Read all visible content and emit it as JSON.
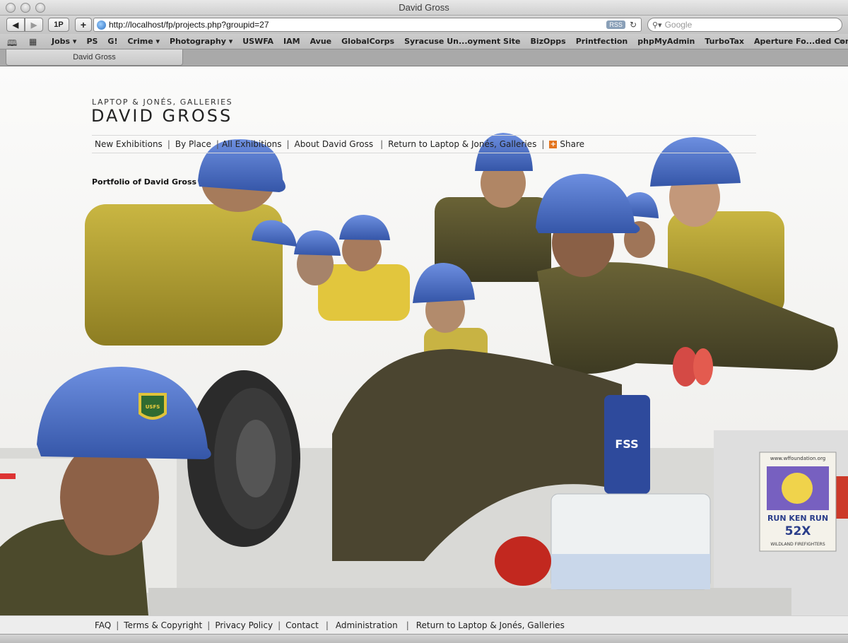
{
  "window": {
    "title": "David Gross"
  },
  "toolbar": {
    "back_icon": "back-arrow-icon",
    "forward_icon": "forward-arrow-icon",
    "onepassword_label": "1P",
    "add_label": "+",
    "url": "http://localhost/fp/projects.php?groupid=27",
    "rss_label": "RSS",
    "search_placeholder": "Google"
  },
  "bookmarks": {
    "items": [
      "Jobs ▾",
      "PS",
      "G!",
      "Crime ▾",
      "Photography ▾",
      "USWFA",
      "IAM",
      "Avue",
      "GlobalCorps",
      "Syracuse Un...oyment Site",
      "BizOpps",
      "Printfection",
      "phpMyAdmin",
      "TurboTax",
      "Aperture Fo...ded Content"
    ]
  },
  "tab": {
    "label": "David Gross"
  },
  "site": {
    "subtitle": "LAPTOP & JONÉS, GALLERIES",
    "title": "DAVID GROSS",
    "portfolio_label": "Portfolio of David Gross"
  },
  "nav": {
    "new_exhibitions": "New Exhibitions",
    "by_place": "By Place",
    "all_exhibitions": "All Exhibitions",
    "about": "About David Gross",
    "return": "Return to Laptop & Jonés, Galleries",
    "share": "Share"
  },
  "footer": {
    "faq": "FAQ",
    "terms": "Terms & Copyright",
    "privacy": "Privacy Policy",
    "contact": "Contact",
    "administration": "Administration",
    "return": "Return to Laptop & Jonés, Galleries"
  },
  "photo": {
    "helmet_badge": "USFS",
    "bag_label": "FSS",
    "sticker_url": "www.wffoundation.org",
    "sticker_title": "RUN KEN RUN",
    "sticker_number": "52X",
    "sticker_footer": "WILDLAND FIREFIGHTERS"
  },
  "colors": {
    "helmet": "#4a70c8",
    "shirt": "#b9a431",
    "tire": "#2b2b2b"
  }
}
